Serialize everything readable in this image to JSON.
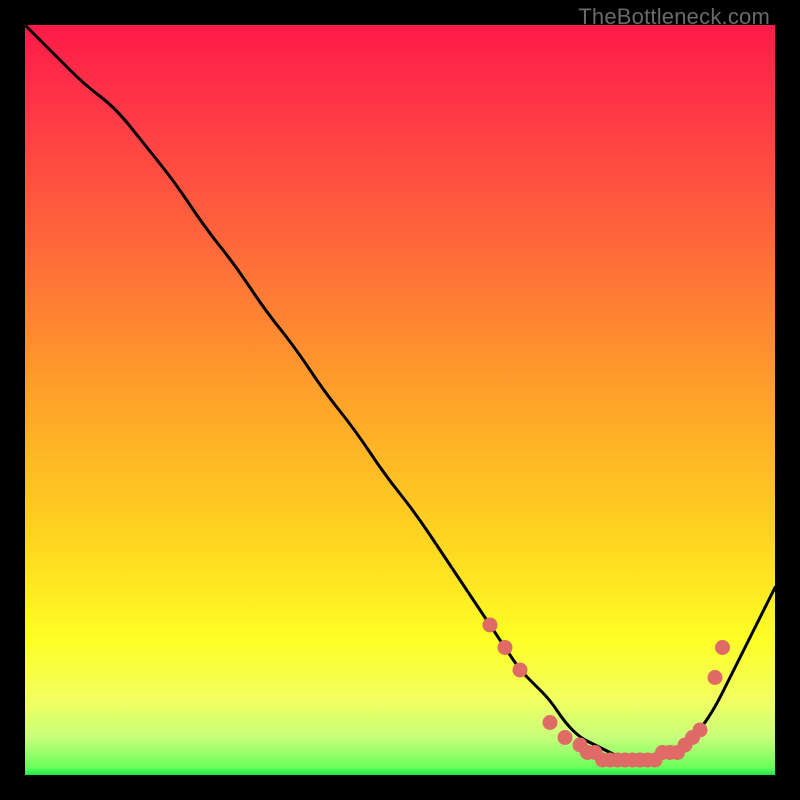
{
  "watermark": "TheBottleneck.com",
  "colors": {
    "gradient": {
      "top": "#ff1a49",
      "s1": "#ff3447",
      "s2": "#ff6a3a",
      "s3": "#ffa329",
      "s4": "#ffd91f",
      "s5": "#fdff25",
      "s6": "#f1ff60",
      "s7": "#c8ff7a",
      "s8": "#6aff5a",
      "bot": "#15e84e"
    },
    "curve": "#000000",
    "dot": "#df6a66"
  },
  "chart_data": {
    "type": "line",
    "title": "",
    "xlabel": "",
    "ylabel": "",
    "xlim": [
      0,
      100
    ],
    "ylim": [
      0,
      100
    ],
    "series": [
      {
        "name": "bottleneck-curve",
        "x": [
          0,
          4,
          8,
          12,
          16,
          20,
          24,
          28,
          32,
          36,
          40,
          44,
          48,
          52,
          56,
          60,
          62,
          64,
          66,
          68,
          70,
          72,
          74,
          76,
          78,
          80,
          82,
          84,
          86,
          88,
          90,
          92,
          94,
          96,
          98,
          100
        ],
        "y": [
          100,
          96,
          92,
          89,
          84,
          79,
          73,
          68,
          62,
          57,
          51,
          46,
          40,
          35,
          29,
          23,
          20,
          17,
          14,
          12,
          10,
          7,
          5,
          4,
          3,
          2,
          2,
          2,
          3,
          4,
          6,
          9,
          13,
          17,
          21,
          25
        ]
      }
    ],
    "markers": {
      "name": "highlight-dots",
      "x": [
        62,
        64,
        66,
        70,
        72,
        74,
        75,
        76,
        77,
        78,
        79,
        80,
        81,
        82,
        83,
        84,
        85,
        86,
        87,
        88,
        89,
        90,
        92,
        93
      ],
      "y": [
        20,
        17,
        14,
        7,
        5,
        4,
        3,
        3,
        2,
        2,
        2,
        2,
        2,
        2,
        2,
        2,
        3,
        3,
        3,
        4,
        5,
        6,
        13,
        17
      ]
    }
  }
}
